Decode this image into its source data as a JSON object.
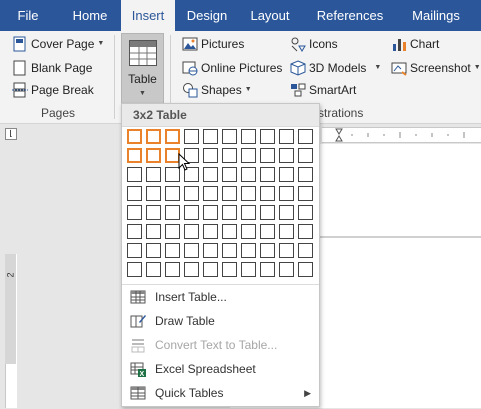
{
  "tabs": [
    "File",
    "Home",
    "Insert",
    "Design",
    "Layout",
    "References",
    "Mailings"
  ],
  "active_tab": "Insert",
  "ribbon": {
    "pages_group": {
      "cover_page": "Cover Page",
      "blank_page": "Blank Page",
      "page_break": "Page Break",
      "label": "Pages"
    },
    "table_button": "Table",
    "illustrations_group": {
      "pictures": "Pictures",
      "online_pictures": "Online Pictures",
      "shapes": "Shapes",
      "icons": "Icons",
      "models_3d": "3D Models",
      "smartart": "SmartArt",
      "chart": "Chart",
      "screenshot": "Screenshot",
      "label_visible": "strations"
    }
  },
  "table_dropdown": {
    "header": "3x2 Table",
    "grid_cols": 10,
    "grid_rows": 8,
    "selected_cols": 3,
    "selected_rows": 2,
    "items": [
      {
        "label": "Insert Table...",
        "enabled": true,
        "icon": "table-grid-icon"
      },
      {
        "label": "Draw Table",
        "enabled": true,
        "icon": "draw-pencil-icon"
      },
      {
        "label": "Convert Text to Table...",
        "enabled": false,
        "icon": "convert-text-icon"
      },
      {
        "label": "Excel Spreadsheet",
        "enabled": true,
        "icon": "excel-icon"
      },
      {
        "label": "Quick Tables",
        "enabled": true,
        "icon": "quick-tables-icon",
        "submenu": true
      }
    ]
  },
  "ruler": {
    "left_number": "2"
  },
  "colors": {
    "tab_bar": "#2b579a",
    "ribbon": "#f3f3f3",
    "grid_selection": "#e9822a"
  }
}
